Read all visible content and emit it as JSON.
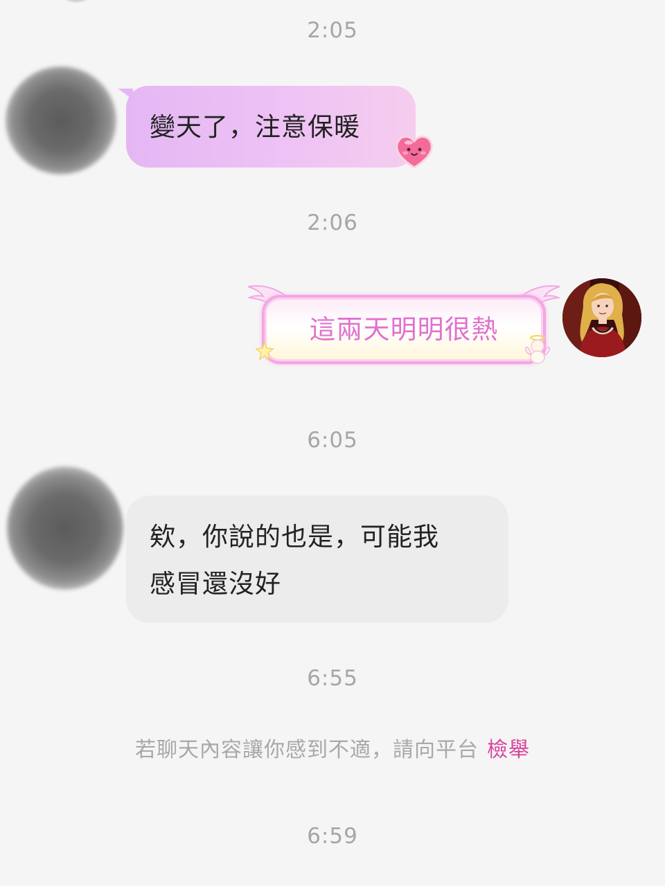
{
  "conversation": {
    "timestamps": [
      "2:05",
      "2:06",
      "6:05",
      "6:55",
      "6:59"
    ],
    "messages": [
      {
        "side": "left",
        "style": "pink-bubble",
        "lines": [
          "變天了，注意保暖"
        ],
        "sticker": "heart-face-sticker"
      },
      {
        "side": "right",
        "style": "angel-wing-bubble",
        "lines": [
          "這兩天明明很熱"
        ]
      },
      {
        "side": "left",
        "style": "grey-bubble",
        "lines": [
          "欸，你說的也是，可能我",
          "感冒還沒好"
        ]
      }
    ],
    "notice": {
      "text": "若聊天內容讓你感到不適，請向平台",
      "link": "檢舉"
    }
  },
  "colors": {
    "background": "#f5f5f5",
    "timestamp": "#a6a6a6",
    "pink_bubble": "#eec2f5",
    "grey_bubble": "#ececec",
    "fancy_text": "#e072cf",
    "report_link": "#d9449c"
  }
}
